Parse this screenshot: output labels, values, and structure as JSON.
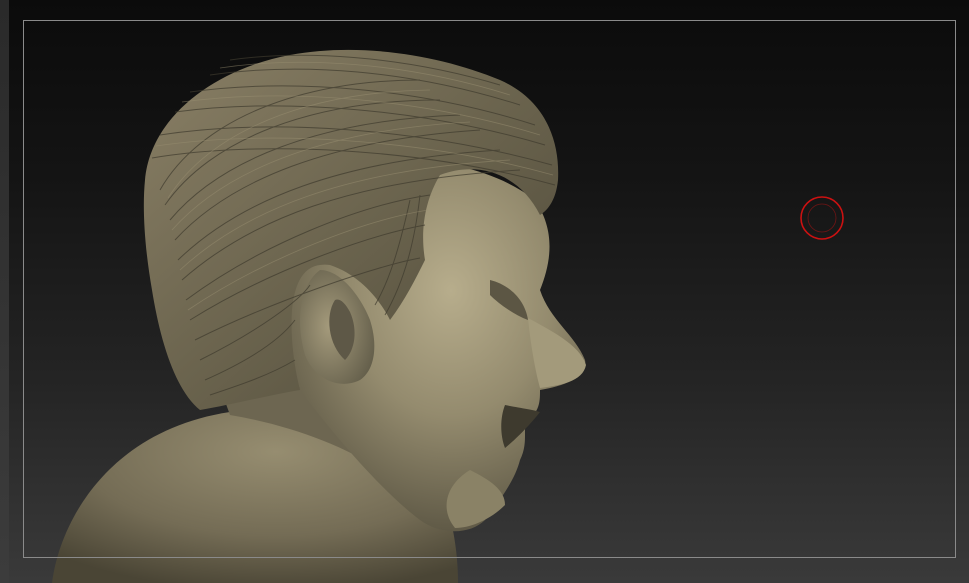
{
  "viewport": {
    "background_top": "#0b0b0b",
    "background_bottom": "#3a3a3a",
    "frame_color": "#8a8a8a"
  },
  "model": {
    "subject": "sculpted-male-head-bust",
    "material_color": "#8a8166",
    "hair_color": "#6e6650"
  },
  "brush_cursor": {
    "color": "#cc1111",
    "icon": "brush-circle-icon"
  }
}
